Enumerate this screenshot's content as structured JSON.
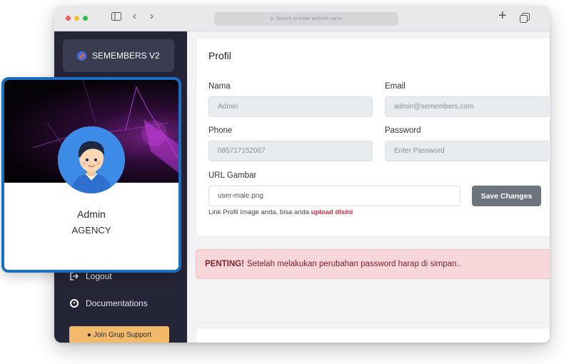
{
  "browser": {
    "url_placeholder": "Search or enter website name",
    "toolbar_icons": [
      "sidebar-icon",
      "back-icon",
      "forward-icon",
      "new-tab-icon",
      "tabs-icon"
    ]
  },
  "sidebar": {
    "brand": "SEMEMBERS V2",
    "logout_label": "Logout",
    "documentations_label": "Documentations",
    "support_label": "Join Grup Support"
  },
  "profile_card": {
    "name": "Admin",
    "role": "AGENCY"
  },
  "form": {
    "title": "Profil",
    "nama_label": "Nama",
    "nama_value": "Admin",
    "email_label": "Email",
    "email_value": "admin@semembers.com",
    "phone_label": "Phone",
    "phone_value": "085717152067",
    "password_label": "Password",
    "password_placeholder": "Enter Password",
    "url_label": "URL Gambar",
    "url_value": "user-male.png",
    "save_label": "Save Changes",
    "hint_text": "Link Profil Image anda, bisa anda ",
    "hint_link": "upload disini"
  },
  "alert": {
    "strong": "PENTING!",
    "text": "Setelah melakukan perubahan password harap di simpan.."
  },
  "colors": {
    "sidebar_bg": "#252538",
    "accent_border": "#1b6ec2",
    "alert_bg": "#f8d7da",
    "save_button": "#6c757d",
    "support_button": "#f3b96b"
  }
}
